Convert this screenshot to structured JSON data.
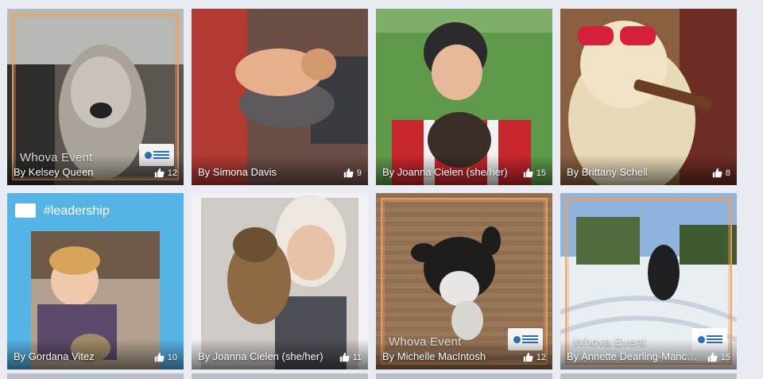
{
  "tiles": [
    {
      "author": "By Kelsey Queen",
      "likes": "12",
      "watermark": "Whova Event",
      "kind": "whova",
      "bg": "#6d675e"
    },
    {
      "author": "By Simona Davis",
      "likes": "9",
      "kind": "plain",
      "bg": "#7a5b53"
    },
    {
      "author": "By Joanna Cielen (she/her)",
      "likes": "15",
      "kind": "plain",
      "bg": "#5e8f4e"
    },
    {
      "author": "By Brittany Schell",
      "likes": "8",
      "kind": "plain",
      "bg": "#8c6a4c"
    },
    {
      "author": "By Gordana Vitez",
      "likes": "10",
      "tag": "#leadership",
      "kind": "tag",
      "bg": "#56b1e4"
    },
    {
      "author": "By Joanna Cielen (she/her)",
      "likes": "11",
      "kind": "plain",
      "bg": "#c9c5c2"
    },
    {
      "author": "By Michelle MacIntosh",
      "likes": "12",
      "watermark": "Whova Event",
      "kind": "whova",
      "bg": "#8b6b52"
    },
    {
      "author": "By Annette Dearling-Manch…",
      "likes": "15",
      "watermark": "Whova Event",
      "kind": "whova",
      "bg": "#b9c8d8"
    }
  ],
  "icons": {
    "like": "thumbs-up-icon",
    "logo": "niagara-college-logo-icon"
  }
}
